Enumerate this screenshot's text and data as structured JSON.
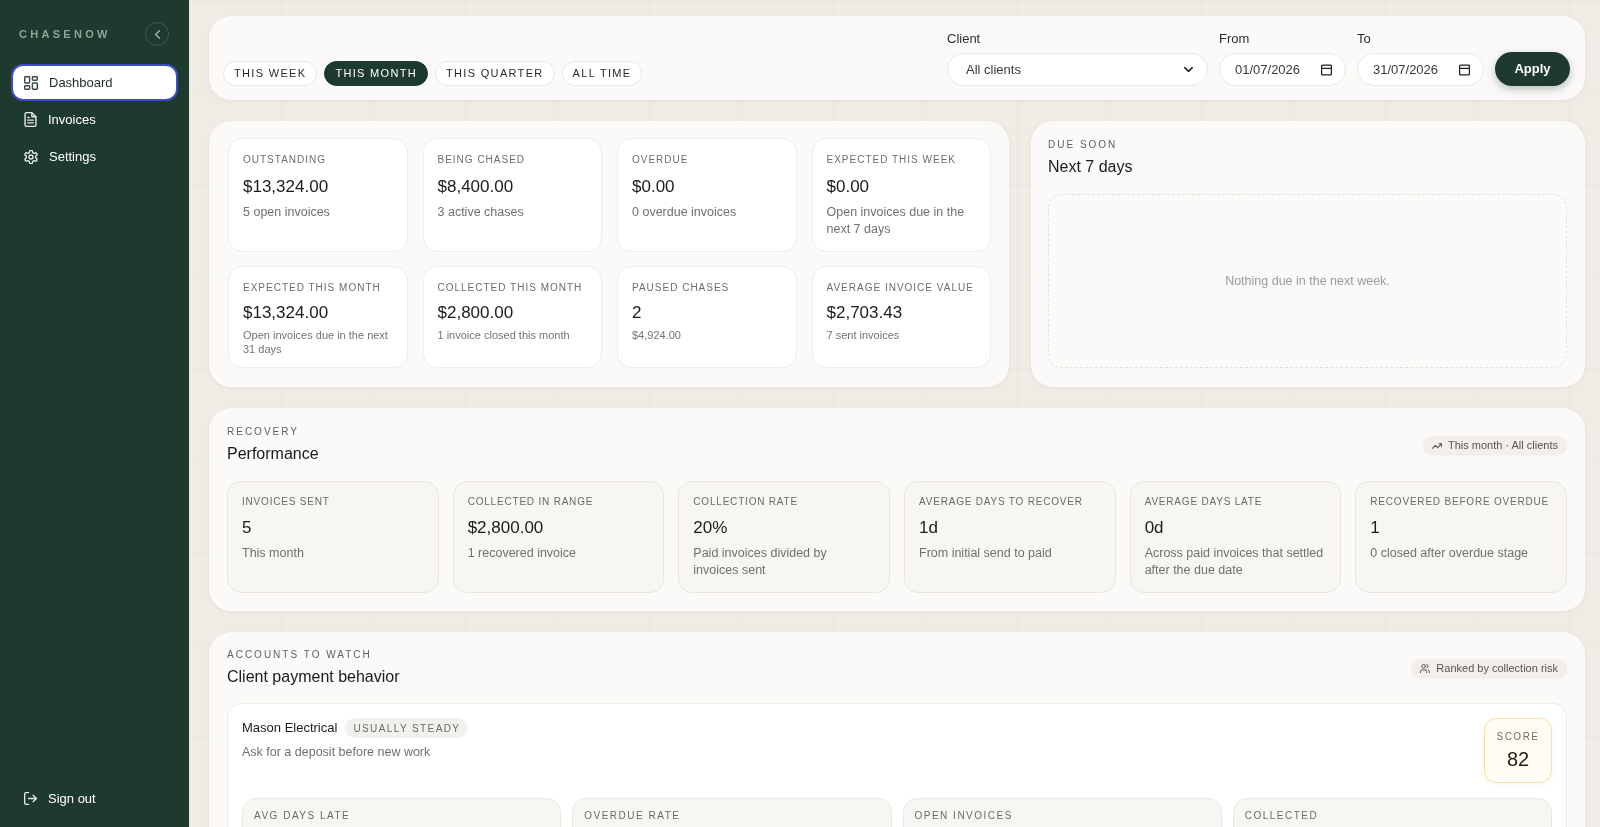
{
  "sidebar": {
    "brand": "CHASENOW",
    "items": [
      {
        "label": "Dashboard",
        "selected": true
      },
      {
        "label": "Invoices",
        "selected": false
      },
      {
        "label": "Settings",
        "selected": false
      }
    ],
    "sign_out": "Sign out"
  },
  "filters": {
    "periods": [
      {
        "label": "THIS WEEK",
        "selected": false
      },
      {
        "label": "THIS MONTH",
        "selected": true
      },
      {
        "label": "THIS QUARTER",
        "selected": false
      },
      {
        "label": "ALL TIME",
        "selected": false
      }
    ],
    "client": {
      "label": "Client",
      "value": "All clients"
    },
    "from": {
      "label": "From",
      "value": "01/07/2026"
    },
    "to": {
      "label": "To",
      "value": "31/07/2026"
    },
    "apply": "Apply"
  },
  "summary": {
    "rows": [
      [
        {
          "label": "OUTSTANDING",
          "value": "$13,324.00",
          "note": "5 open invoices"
        },
        {
          "label": "BEING CHASED",
          "value": "$8,400.00",
          "note": "3 active chases"
        },
        {
          "label": "OVERDUE",
          "value": "$0.00",
          "note": "0 overdue invoices"
        },
        {
          "label": "EXPECTED THIS WEEK",
          "value": "$0.00",
          "note": "Open invoices due in the next 7 days"
        }
      ],
      [
        {
          "label": "EXPECTED THIS MONTH",
          "value": "$13,324.00",
          "note": "Open invoices due in the next 31 days"
        },
        {
          "label": "COLLECTED THIS MONTH",
          "value": "$2,800.00",
          "note": "1 invoice closed this month"
        },
        {
          "label": "PAUSED CHASES",
          "value": "2",
          "note": "$4,924.00"
        },
        {
          "label": "AVERAGE INVOICE VALUE",
          "value": "$2,703.43",
          "note": "7 sent invoices"
        }
      ]
    ]
  },
  "due_soon": {
    "eyebrow": "DUE SOON",
    "title": "Next 7 days",
    "empty": "Nothing due in the next week."
  },
  "recovery": {
    "eyebrow": "RECOVERY",
    "title": "Performance",
    "scope": "This month · All clients",
    "cards": [
      {
        "label": "INVOICES SENT",
        "value": "5",
        "note": "This month"
      },
      {
        "label": "COLLECTED IN RANGE",
        "value": "$2,800.00",
        "note": "1 recovered invoice"
      },
      {
        "label": "COLLECTION RATE",
        "value": "20%",
        "note": "Paid invoices divided by invoices sent"
      },
      {
        "label": "AVERAGE DAYS TO RECOVER",
        "value": "1d",
        "note": "From initial send to paid"
      },
      {
        "label": "AVERAGE DAYS LATE",
        "value": "0d",
        "note": "Across paid invoices that settled after the due date"
      },
      {
        "label": "RECOVERED BEFORE OVERDUE",
        "value": "1",
        "note": "0 closed after overdue stage"
      }
    ]
  },
  "accounts": {
    "eyebrow": "ACCOUNTS TO WATCH",
    "title": "Client payment behavior",
    "scope": "Ranked by collection risk",
    "clients": [
      {
        "name": "Mason Electrical",
        "tag": "USUALLY STEADY",
        "advice": "Ask for a deposit before new work",
        "score_label": "SCORE",
        "score": "82",
        "metrics": [
          "AVG DAYS LATE",
          "OVERDUE RATE",
          "OPEN INVOICES",
          "COLLECTED"
        ]
      }
    ]
  }
}
